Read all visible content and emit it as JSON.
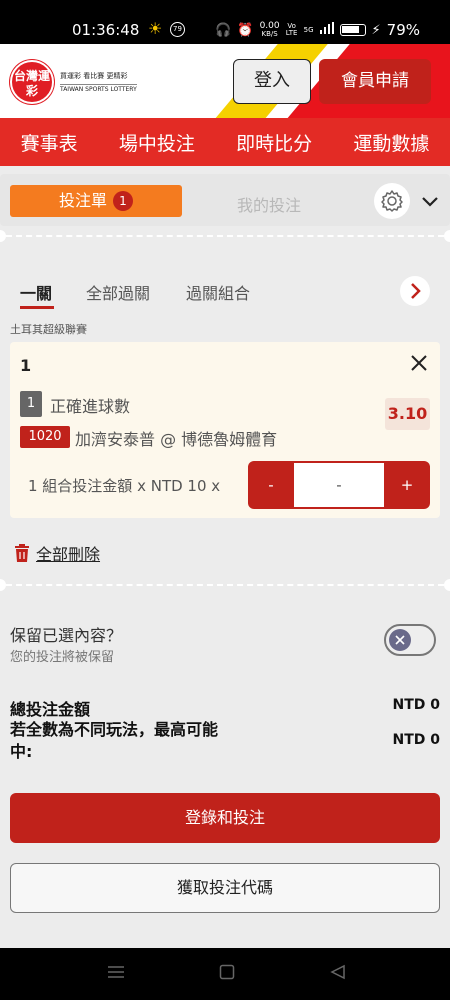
{
  "status_bar": {
    "time": "01:36:48",
    "weather_badge": "79",
    "data_speed_value": "0.00",
    "data_speed_unit": "KB/S",
    "volte": "Vo LTE",
    "network": "5G",
    "battery": "79%"
  },
  "header": {
    "logo_text": "台灣運彩",
    "logo_tagline": "買運彩 看比賽 更精彩",
    "logo_english": "TAIWAN SPORTS LOTTERY",
    "login_label": "登入",
    "join_label": "會員申請"
  },
  "nav": {
    "items": [
      "賽事表",
      "場中投注",
      "即時比分",
      "運動數據"
    ]
  },
  "betslip": {
    "tab_label": "投注單",
    "tab_count": "1",
    "my_bets_label": "我的投注",
    "subtabs": [
      "一關",
      "全部過關",
      "過關組合"
    ],
    "league": "土耳其超級聯賽",
    "card": {
      "number": "1",
      "selection_index": "1",
      "selection_name": "正確進球數",
      "odds": "3.10",
      "match_code": "1020",
      "match_name": "加濟安泰普 @ 博德魯姆體育",
      "stake_label": "1 組合投注金額 x NTD 10 x",
      "minus": "-",
      "stake_value": "-",
      "plus": "+"
    },
    "delete_all": "全部刪除",
    "keep_label": "保留已選內容？",
    "keep_sub": "您的投注將被保留",
    "total_label": "總投注金額",
    "total_value": "NTD 0",
    "max_label": "若全數為不同玩法，最高可能中:",
    "max_value": "NTD 0",
    "login_bet_button": "登錄和投注",
    "get_code_button": "獲取投注代碼"
  },
  "colors": {
    "brand_red": "#c0221b",
    "nav_red": "#e32b25",
    "orange": "#f47b1f",
    "yellow": "#f5d100"
  }
}
